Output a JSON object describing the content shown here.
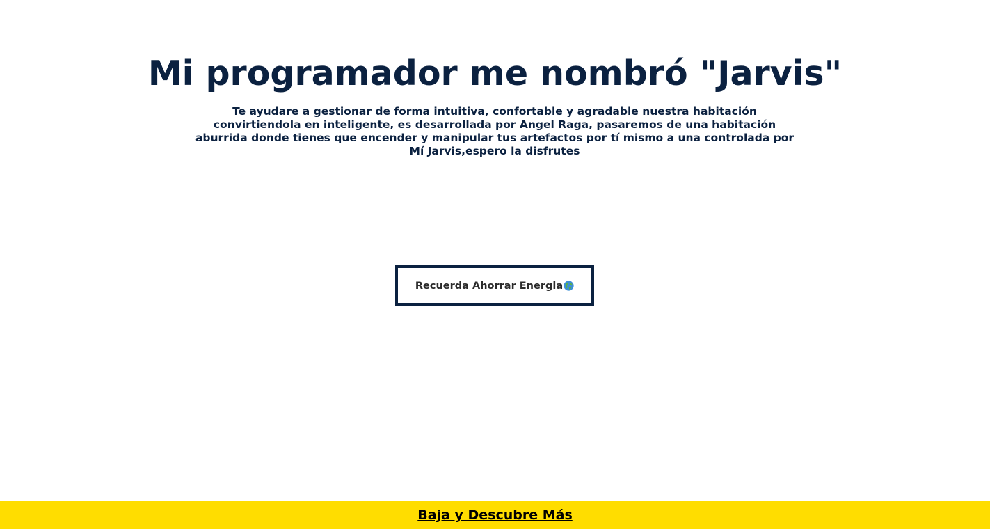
{
  "hero": {
    "title": "Mi programador me nombró \"Jarvis\"",
    "description": "Te ayudare a gestionar de forma intuitiva, confortable y agradable nuestra habitación convirtiendola en inteligente, es desarrollada por Angel Raga, pasaremos de una habitación aburrida donde tienes que encender y manipular tus artefactos por tí mismo a una controlada por Mí Jarvis,espero la disfrutes",
    "cta": {
      "label": "Recuerda Ahorrar Energia",
      "icon": "globe-icon"
    }
  },
  "footer": {
    "link_label": "Baja y Descubre Más"
  },
  "colors": {
    "primary_text": "#0b2140",
    "footer_background": "#ffdd00",
    "background": "#ffffff"
  }
}
